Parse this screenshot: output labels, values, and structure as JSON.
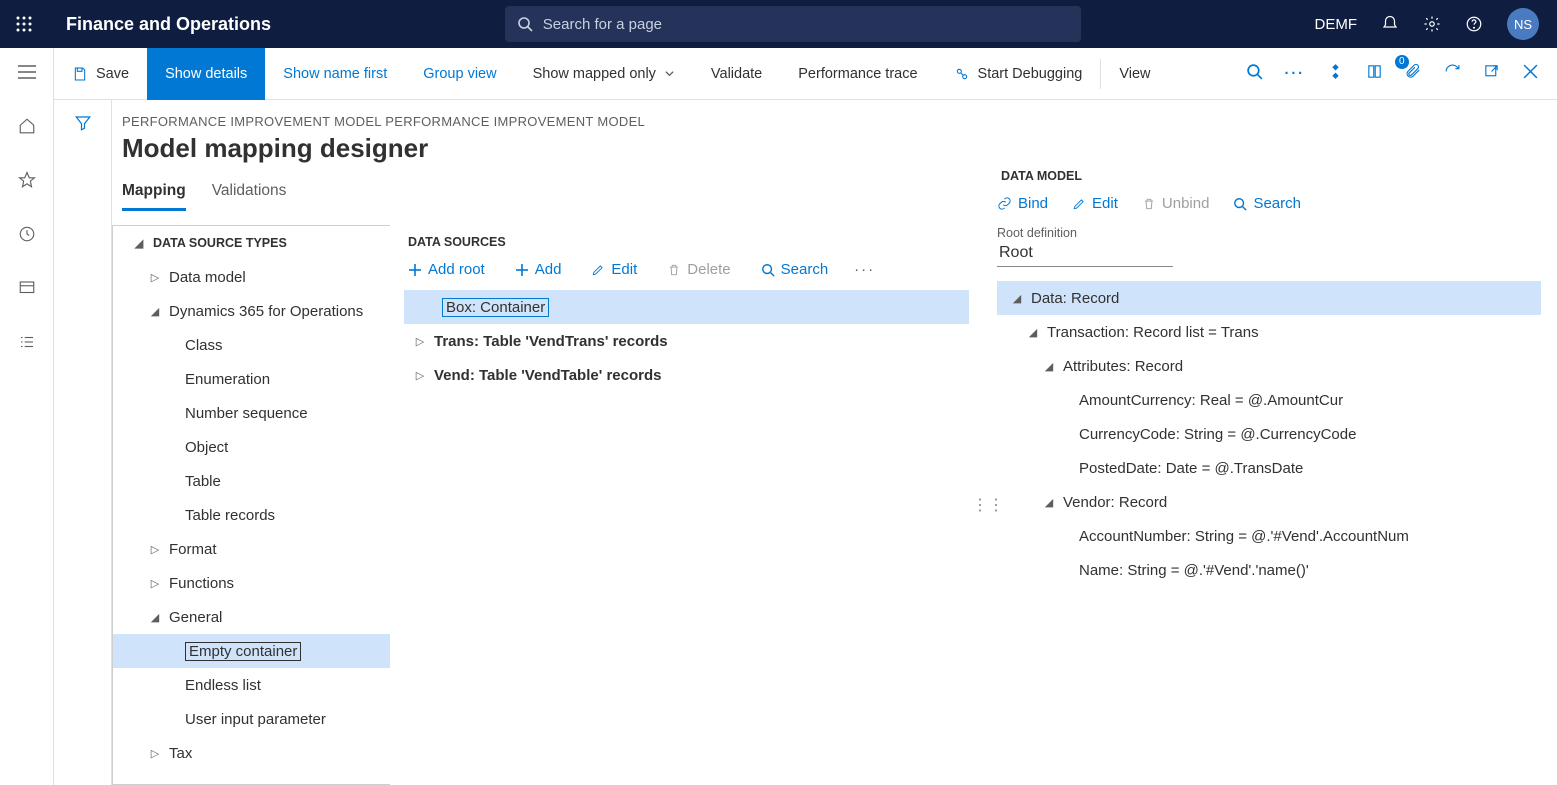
{
  "top": {
    "brand": "Finance and Operations",
    "searchPlaceholder": "Search for a page",
    "entity": "DEMF",
    "avatar": "NS"
  },
  "actions": {
    "save": "Save",
    "showDetails": "Show details",
    "showNameFirst": "Show name first",
    "groupView": "Group view",
    "showMappedOnly": "Show mapped only",
    "validate": "Validate",
    "perfTrace": "Performance trace",
    "startDebug": "Start Debugging",
    "view": "View",
    "badge": "0"
  },
  "header": {
    "breadcrumb": "PERFORMANCE IMPROVEMENT MODEL PERFORMANCE IMPROVEMENT MODEL",
    "title": "Model mapping designer",
    "tabs": {
      "mapping": "Mapping",
      "validations": "Validations"
    }
  },
  "dst": {
    "hdr": "DATA SOURCE TYPES",
    "items": {
      "dataModel": "Data model",
      "d365": "Dynamics 365 for Operations",
      "class": "Class",
      "enum": "Enumeration",
      "numseq": "Number sequence",
      "object": "Object",
      "table": "Table",
      "tablerec": "Table records",
      "format": "Format",
      "functions": "Functions",
      "general": "General",
      "emptyContainer": "Empty container",
      "endlessList": "Endless list",
      "userInput": "User input parameter",
      "tax": "Tax"
    }
  },
  "ds": {
    "hdr": "DATA SOURCES",
    "tb": {
      "addroot": "Add root",
      "add": "Add",
      "edit": "Edit",
      "delete": "Delete",
      "search": "Search"
    },
    "rows": {
      "box": "Box: Container",
      "trans": "Trans: Table 'VendTrans' records",
      "vend": "Vend: Table 'VendTable' records"
    }
  },
  "dm": {
    "hdr": "DATA MODEL",
    "tb": {
      "bind": "Bind",
      "edit": "Edit",
      "unbind": "Unbind",
      "search": "Search"
    },
    "rootLbl": "Root definition",
    "rootVal": "Root",
    "nodes": {
      "data": "Data: Record",
      "transaction": "Transaction: Record list = Trans",
      "attributes": "Attributes: Record",
      "amount": "AmountCurrency: Real = @.AmountCur",
      "currency": "CurrencyCode: String = @.CurrencyCode",
      "posted": "PostedDate: Date = @.TransDate",
      "vendor": "Vendor: Record",
      "acct": "AccountNumber: String = @.'#Vend'.AccountNum",
      "name": "Name: String = @.'#Vend'.'name()'"
    }
  }
}
